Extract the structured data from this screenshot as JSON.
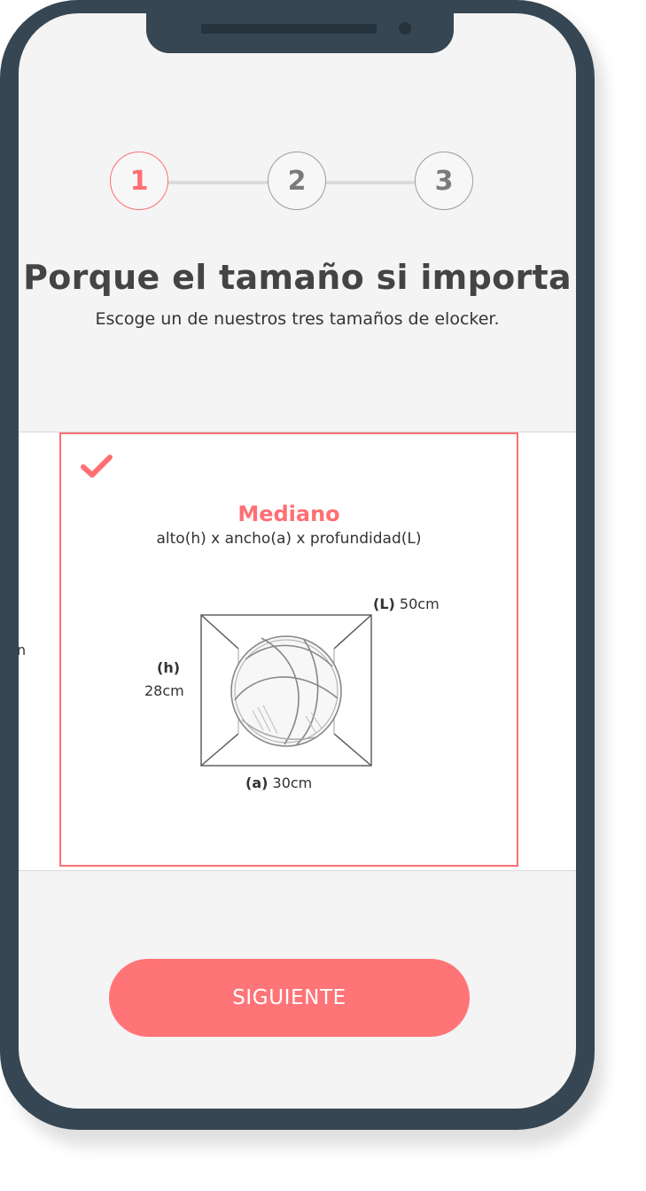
{
  "stepper": {
    "steps": [
      {
        "label": "1",
        "active": true
      },
      {
        "label": "2",
        "active": false
      },
      {
        "label": "3",
        "active": false
      }
    ]
  },
  "header": {
    "title": "Porque el tamaño si importa",
    "subtitle": "Escoge un de nuestros tres tamaños de elocker."
  },
  "carousel": {
    "previous_card_peek_text": "n",
    "selected_card": {
      "name": "Mediano",
      "formula": "alto(h) x ancho(a) x profundidad(L)",
      "depth_label": "(L)",
      "depth_value": "50cm",
      "height_label": "(h)",
      "height_value": "28cm",
      "width_label": "(a)",
      "width_value": "30cm",
      "selected": true,
      "check_icon": "check-icon",
      "illustration": "basketball-in-box"
    }
  },
  "footer": {
    "next_label": "SIGUIENTE"
  },
  "colors": {
    "accent": "#ff6f74",
    "button": "#ff7477",
    "phone_frame": "#364652",
    "screen_bg": "#f4f4f4"
  }
}
